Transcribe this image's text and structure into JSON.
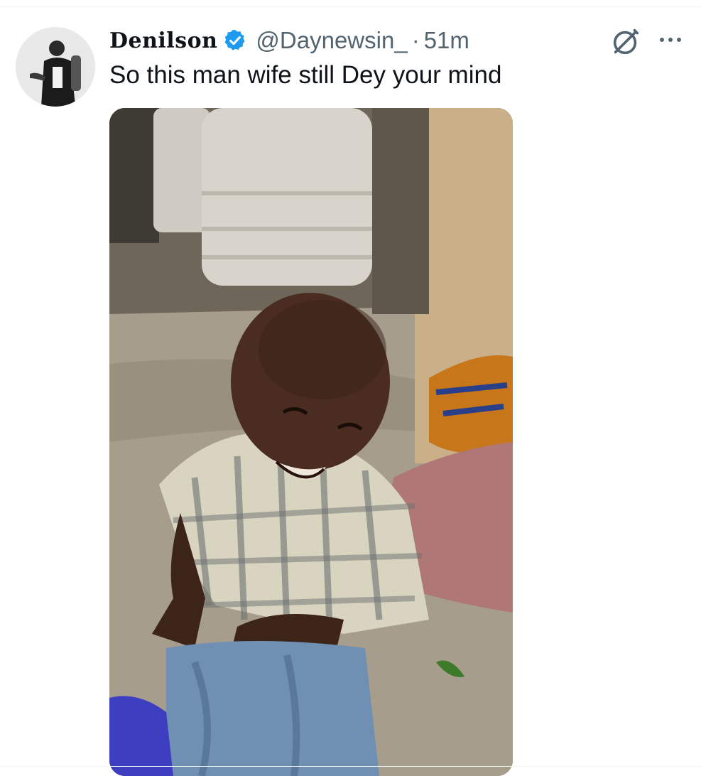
{
  "tweet": {
    "author": {
      "display_name": "Denilson",
      "handle": "@Daynewsin_",
      "verified": true
    },
    "separator": "·",
    "time": "51m",
    "text": "So this man wife still Dey your mind",
    "media": {
      "type": "video-frame",
      "description_icon": "photo"
    }
  },
  "actions": {
    "grok_icon": "grok-icon",
    "more_icon": "more-icon"
  },
  "colors": {
    "verified_blue": "#1d9bf0",
    "secondary_text": "#536471",
    "primary_text": "#0f1419"
  }
}
